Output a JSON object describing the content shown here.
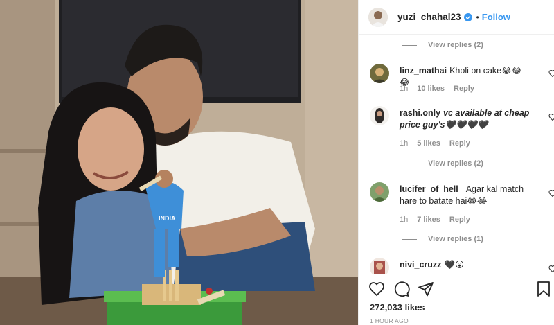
{
  "post": {
    "author": "yuzi_chahal23",
    "dot": "•",
    "follow_label": "Follow",
    "likes": "272,033 likes",
    "time": "1 HOUR AGO"
  },
  "comments": [
    {
      "kind": "replies",
      "label": "View replies (2)"
    },
    {
      "kind": "comment",
      "user": "linz_mathai",
      "text": "Kholi on cake😂😂😂",
      "italic": false,
      "age": "1h",
      "likes": "10 likes",
      "reply": "Reply"
    },
    {
      "kind": "comment",
      "user": "rashi.only",
      "text": "vc available at cheap price guy's🖤🖤🖤🖤",
      "italic": true,
      "age": "1h",
      "likes": "5 likes",
      "reply": "Reply"
    },
    {
      "kind": "replies",
      "label": "View replies (2)"
    },
    {
      "kind": "comment",
      "user": "lucifer_of_hell_",
      "text": "Agar kal match hare to batate hai😂😂",
      "italic": false,
      "age": "1h",
      "likes": "7 likes",
      "reply": "Reply"
    },
    {
      "kind": "replies",
      "label": "View replies (1)"
    },
    {
      "kind": "comment",
      "user": "nivi_cruzz",
      "text": "🖤😮",
      "italic": false
    }
  ],
  "photo": {
    "jersey_text": "INDIA"
  },
  "icons": {
    "verified": "verified-badge-icon",
    "like": "heart-icon",
    "comment": "comment-icon",
    "share": "share-icon",
    "save": "bookmark-icon"
  },
  "colors": {
    "accent": "#3897f0",
    "text": "#262626",
    "muted": "#8e8e8e",
    "border": "#efefef"
  }
}
